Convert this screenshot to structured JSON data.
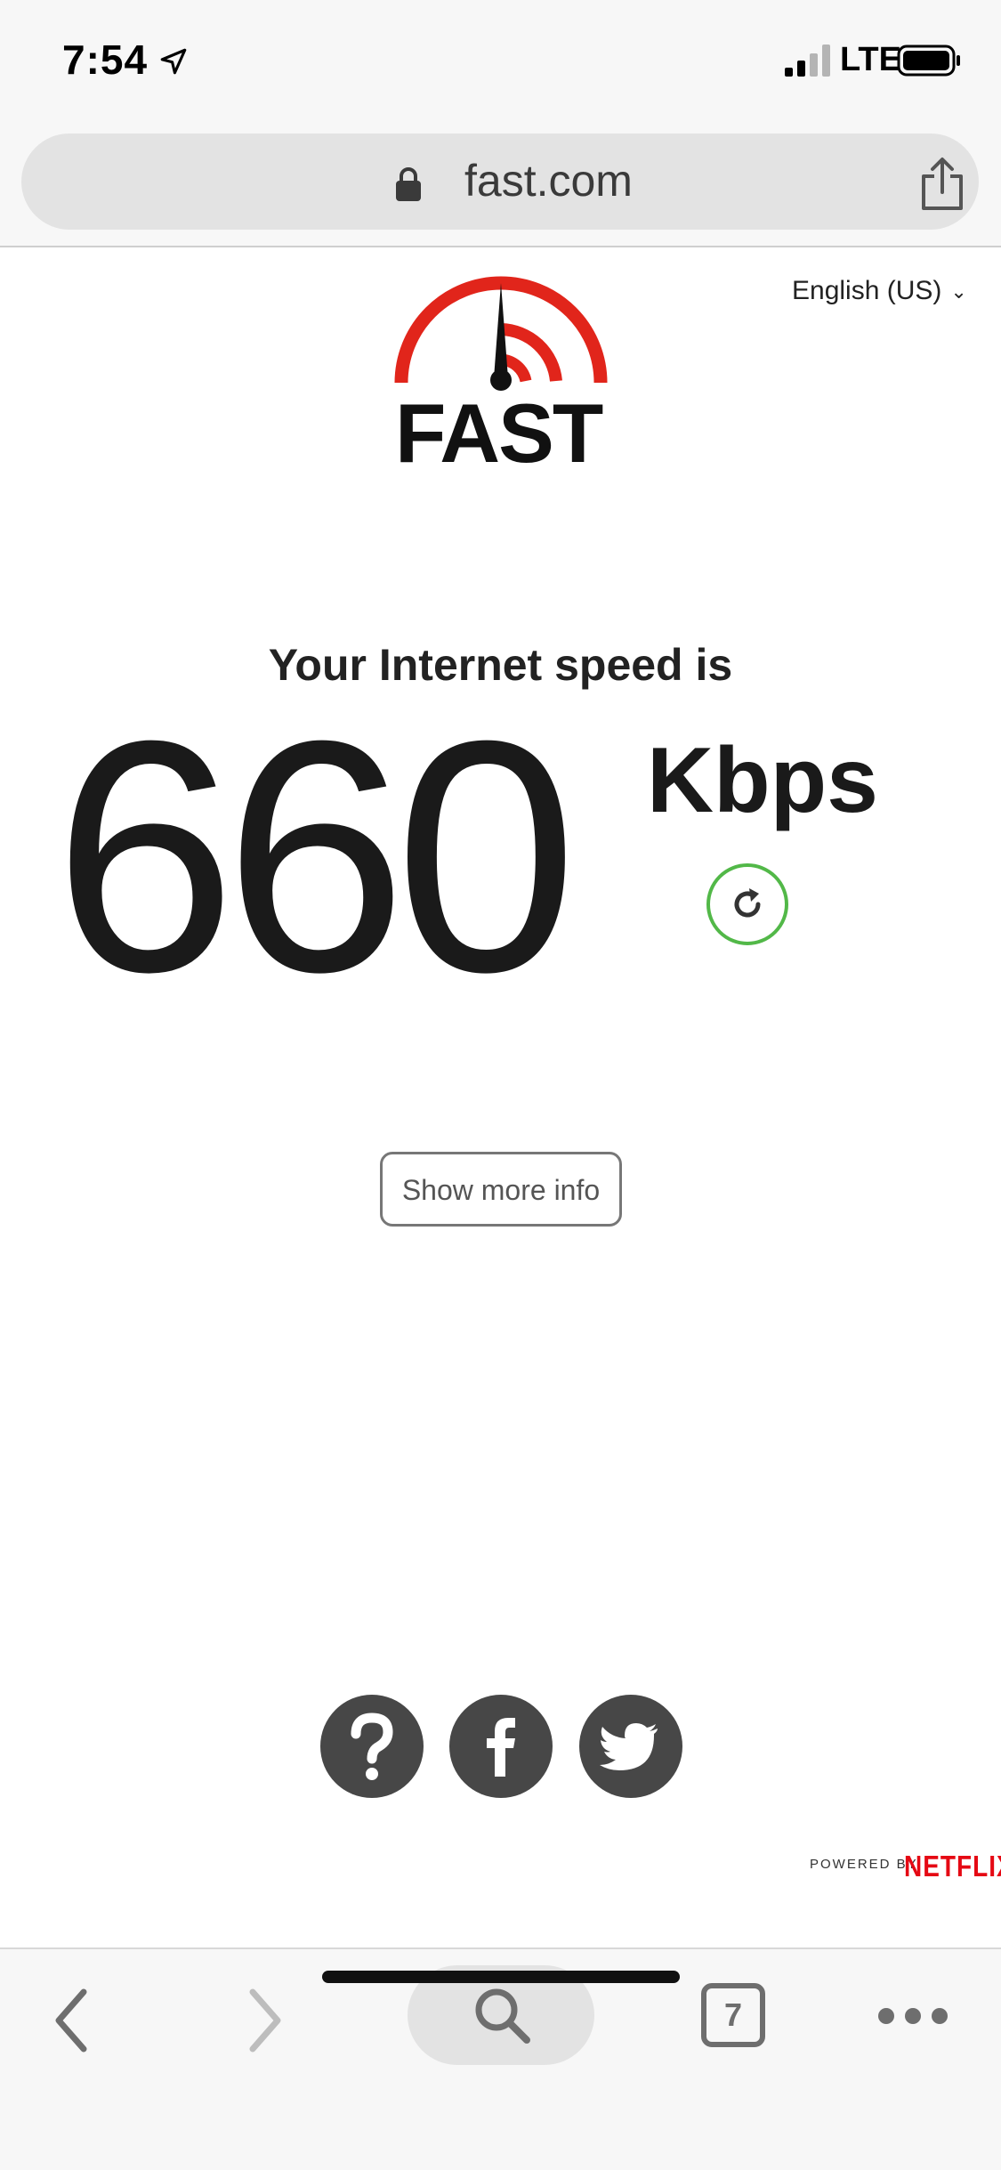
{
  "status_bar": {
    "time": "7:54",
    "network": "LTE"
  },
  "browser": {
    "url": "fast.com",
    "open_tabs": "7"
  },
  "page": {
    "language": "English (US)",
    "logo_text": "FAST",
    "heading": "Your Internet speed is",
    "speed_value": "660",
    "speed_unit": "Kbps",
    "more_info_label": "Show more info",
    "powered_by": "POWERED BY",
    "netflix": "NETFLIX"
  },
  "colors": {
    "brand_red": "#e1251b",
    "refresh_green": "#52b848",
    "social_gray": "#474747",
    "netflix_red": "#e50914"
  },
  "icons": {
    "location": "location-arrow-icon",
    "signal": "signal-bars-icon",
    "battery": "battery-icon",
    "lock": "lock-icon",
    "share": "share-icon",
    "refresh": "refresh-icon",
    "help": "question-icon",
    "facebook": "facebook-icon",
    "twitter": "twitter-icon",
    "back": "chevron-left-icon",
    "forward": "chevron-right-icon",
    "search": "search-icon",
    "more": "more-dots-icon"
  }
}
